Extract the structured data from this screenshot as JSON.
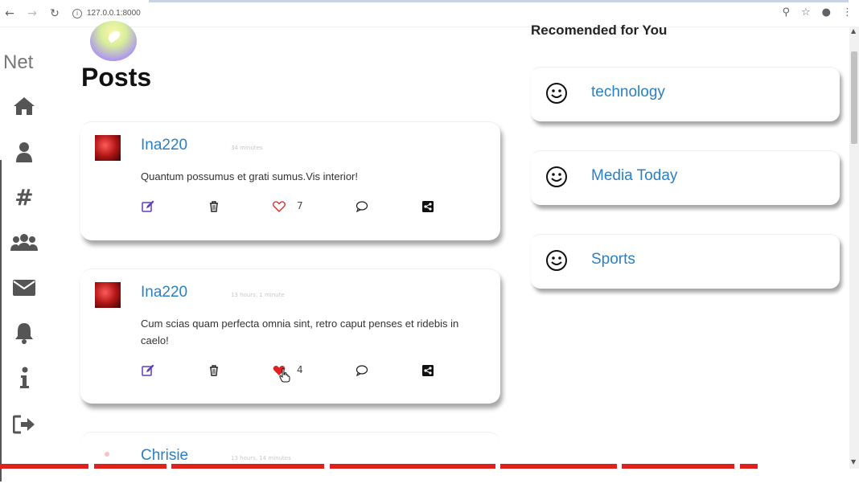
{
  "browser": {
    "url": "127.0.0.1:8000"
  },
  "sidebar": {
    "brand": "Net",
    "items": [
      {
        "icon": "home-icon"
      },
      {
        "icon": "user-icon"
      },
      {
        "icon": "hashtag-icon"
      },
      {
        "icon": "group-icon"
      },
      {
        "icon": "mail-icon"
      },
      {
        "icon": "bell-icon"
      },
      {
        "icon": "info-icon"
      },
      {
        "icon": "logout-icon"
      }
    ]
  },
  "main": {
    "title": "Posts",
    "posts": [
      {
        "author": "Ina220",
        "time": "34 minutes",
        "text": "Quantum possumus et grati sumus.Vis interior!",
        "likes": "7",
        "liked": false
      },
      {
        "author": "Ina220",
        "time": "13 hours, 1 minute",
        "text": "Cum scias quam perfecta omnia sint, retro caput penses et ridebis in caelo!",
        "likes": "4",
        "liked": true
      },
      {
        "author": "Chrisie",
        "time": "13 hours, 14 minutes"
      }
    ]
  },
  "recommended": {
    "title": "Recomended for You",
    "items": [
      {
        "label": "technology"
      },
      {
        "label": "Media Today"
      },
      {
        "label": "Sports"
      }
    ]
  },
  "colors": {
    "link": "#2b7fc3",
    "like_active": "#e02020",
    "edit": "#5b3fc4",
    "strip": "#e0201c"
  }
}
